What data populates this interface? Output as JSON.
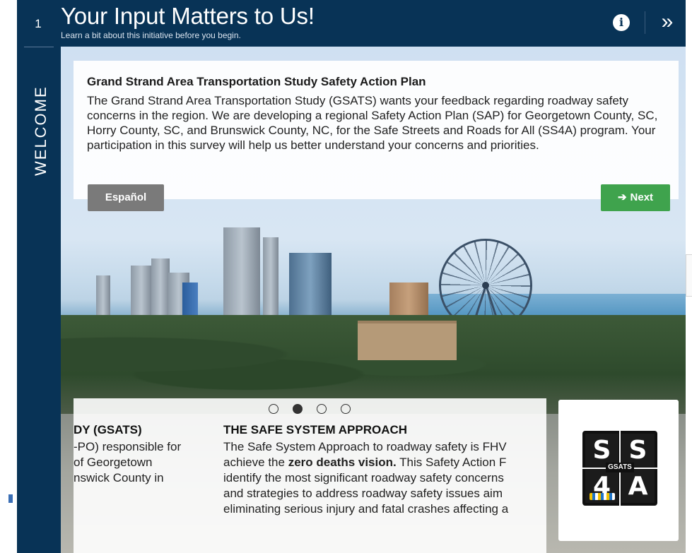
{
  "header": {
    "step_number": "1",
    "title": "Your Input Matters to Us!",
    "subtitle": "Learn a bit about this initiative before you begin.",
    "info_label": "i",
    "expand_label": "»"
  },
  "rail": {
    "label": "WELCOME"
  },
  "intro": {
    "title": "Grand Strand Area Transportation Study Safety Action Plan",
    "body": "The Grand Strand Area Transportation Study (GSATS) wants your feedback regarding roadway safety concerns in the region. We are developing a regional Safety Action Plan (SAP) for Georgetown County, SC, Horry County, SC, and Brunswick County, NC, for the Safe Streets and Roads for All (SS4A) program. Your participation in this survey will help us better understand your concerns and priorities."
  },
  "buttons": {
    "espanol": "Español",
    "next": "Next",
    "next_icon": "➔"
  },
  "carousel": {
    "dots": 4,
    "active_index": 1,
    "slide_a": {
      "title": "DY (GSATS)",
      "lines": [
        "-PO) responsible for",
        "of Georgetown",
        "nswick County in"
      ]
    },
    "slide_b": {
      "title": "THE SAFE SYSTEM APPROACH",
      "lines": [
        "The Safe System Approach to roadway safety is FHV",
        "achieve the ",
        "identify the most significant roadway safety concerns",
        "and strategies to address roadway safety issues aim",
        "eliminating serious injury and fatal crashes affecting a"
      ],
      "bold_phrase": "zero deaths vision.",
      "line2_tail": " This Safety Action F"
    }
  },
  "logo": {
    "top_left": "S",
    "top_right": "S",
    "bottom_left": "4",
    "bottom_right": "A",
    "center_text": "GSATS"
  },
  "corner": {
    "close_label": "⊗"
  },
  "colors": {
    "navy": "#083356",
    "next_green": "#3fa34d",
    "espanol_gray": "#7a7a7a"
  }
}
